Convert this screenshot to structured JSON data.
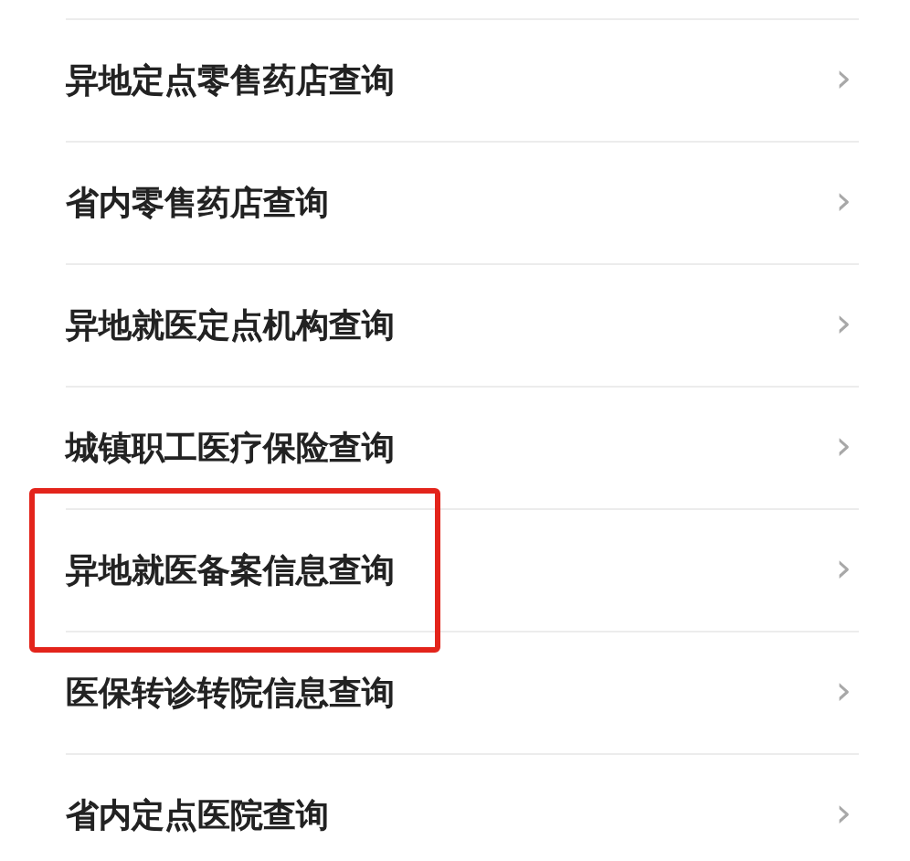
{
  "items": [
    {
      "label": "异地定点零售药店查询",
      "chevron": "›",
      "highlighted": false
    },
    {
      "label": "省内零售药店查询",
      "chevron": "›",
      "highlighted": false
    },
    {
      "label": "异地就医定点机构查询",
      "chevron": "›",
      "highlighted": false
    },
    {
      "label": "城镇职工医疗保险查询",
      "chevron": "›",
      "highlighted": false
    },
    {
      "label": "异地就医备案信息查询",
      "chevron": "›",
      "highlighted": true
    },
    {
      "label": "医保转诊转院信息查询",
      "chevron": "›",
      "highlighted": false
    },
    {
      "label": "省内定点医院查询",
      "chevron": "›",
      "highlighted": false
    }
  ]
}
